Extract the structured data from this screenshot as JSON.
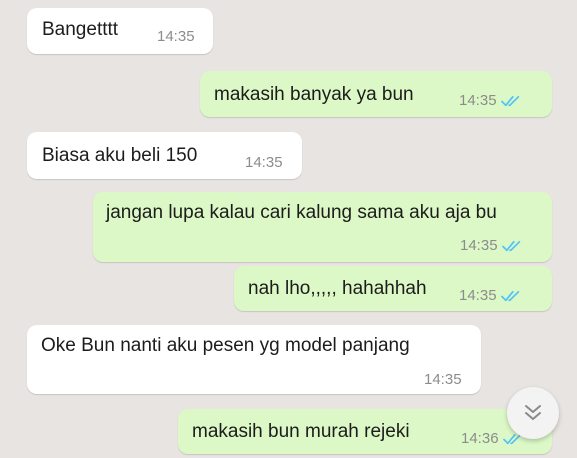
{
  "messages": [
    {
      "direction": "in",
      "text": "Bangetttt",
      "time": "14:35"
    },
    {
      "direction": "out",
      "text": "makasih banyak ya bun",
      "time": "14:35",
      "status": "read"
    },
    {
      "direction": "in",
      "text": "Biasa aku beli 150",
      "time": "14:35"
    },
    {
      "direction": "out",
      "text": "jangan lupa kalau cari kalung sama aku aja bu",
      "time": "14:35",
      "status": "read"
    },
    {
      "direction": "out",
      "text": "nah lho,,,,, hahahhah",
      "time": "14:35",
      "status": "read"
    },
    {
      "direction": "in",
      "text": "Oke Bun nanti aku pesen yg model panjang",
      "time": "14:35"
    },
    {
      "direction": "out",
      "text": "makasih bun murah rejeki",
      "time": "14:36",
      "status": "read"
    }
  ],
  "colors": {
    "background": "#e7e4e1",
    "incoming_bubble": "#ffffff",
    "outgoing_bubble": "#dcf8c6",
    "read_tick": "#4fc3f7",
    "timestamp": "#8c8c8c"
  },
  "icons": {
    "read_receipt": "double-check-icon",
    "scroll_down": "double-chevron-down-icon"
  }
}
